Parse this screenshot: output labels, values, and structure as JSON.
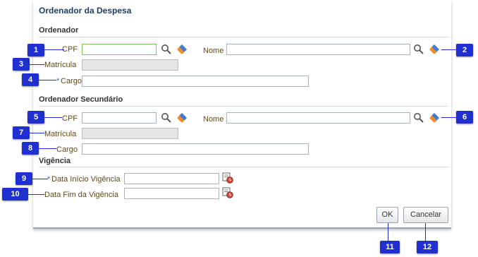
{
  "dialog": {
    "title": "Ordenador da Despesa",
    "ok_label": "OK",
    "cancel_label": "Cancelar"
  },
  "ordenador": {
    "heading": "Ordenador",
    "cpf_label": "CPF",
    "cpf_value": "",
    "nome_label": "Nome",
    "nome_value": "",
    "matricula_label": "Matrícula",
    "cargo_label": "Cargo",
    "cargo_value": ""
  },
  "secundario": {
    "heading": "Ordenador Secundário",
    "cpf_label": "CPF",
    "nome_label": "Nome",
    "matricula_label": "Matrícula",
    "cargo_label": "Cargo"
  },
  "vigencia": {
    "heading": "Vigência",
    "inicio_label": "Data Início Vigência",
    "fim_label": "Data Fim da Vigência"
  },
  "callouts": [
    "1",
    "2",
    "3",
    "4",
    "5",
    "6",
    "7",
    "8",
    "9",
    "10",
    "11",
    "12"
  ],
  "colors": {
    "callout": "#1f2fd0",
    "title": "#1f3e66",
    "label": "#5f4b1a"
  }
}
